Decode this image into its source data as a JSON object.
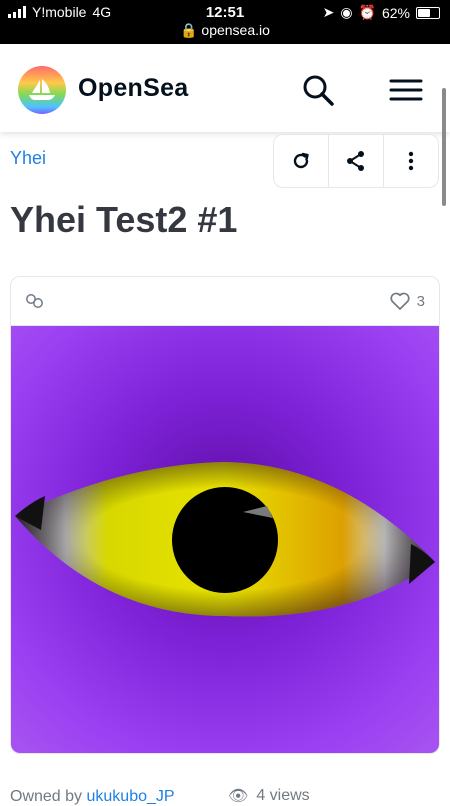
{
  "status": {
    "carrier": "Y!mobile",
    "network": "4G",
    "time": "12:51",
    "url": "opensea.io",
    "battery": "62%",
    "battery_level": 0.62
  },
  "header": {
    "brand": "OpenSea",
    "search_icon": "search-icon",
    "menu_icon": "hamburger-menu-icon"
  },
  "item": {
    "collection": "Yhei",
    "title": "Yhei Test2 #1",
    "favorites": "3",
    "owned_by_prefix": "Owned by",
    "owner": "ukukubo_JP",
    "views": "4 views"
  },
  "actions": [
    "refresh-icon",
    "share-icon",
    "more-icon"
  ],
  "colors": {
    "accent": "#2081e2",
    "title": "#353840",
    "muted": "#707a83",
    "art_background": "#9b3ff2",
    "iris": "#e8e100"
  }
}
